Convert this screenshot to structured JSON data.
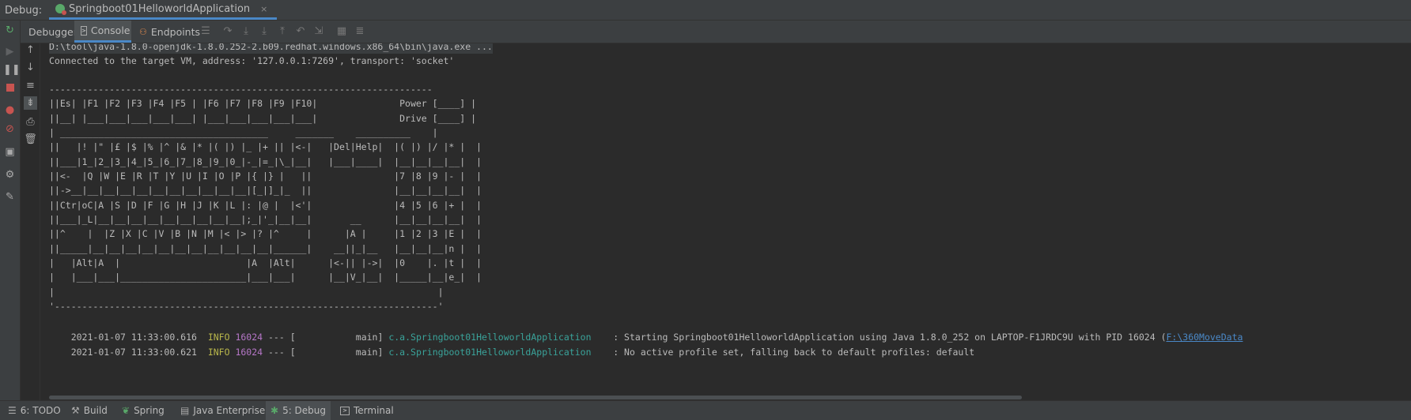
{
  "titlebar": {
    "label": "Debug:",
    "tab": "Springboot01HelloworldApplication",
    "close": "×"
  },
  "tabs": [
    {
      "label": "Debugger"
    },
    {
      "label": "Console"
    },
    {
      "label": "Endpoints"
    }
  ],
  "console": {
    "cmd": "D:\\tool\\java-1.8.0-openjdk-1.8.0.252-2.b09.redhat.windows.x86_64\\bin\\java.exe ...",
    "connected": "Connected to the target VM, address: '127.0.0.1:7269', transport: 'socket'",
    "ascii": [
      "",
      "----------------------------------------------------------------------",
      "||Es| |F1 |F2 |F3 |F4 |F5 | |F6 |F7 |F8 |F9 |F10|               Power [____] |",
      "||__| |___|___|___|___|___| |___|___|___|___|___|               Drive [____] |",
      "| ______________________________________     _______    __________    |",
      "||   |! |\" |£ |$ |% |^ |& |* |( |) |_ |+ || |<-|   |Del|Help|  |( |) |/ |* |  |",
      "||___|1_|2_|3_|4_|5_|6_|7_|8_|9_|0_|-_|=_|\\_|__|   |___|____|  |__|__|__|__|  |",
      "||<-  |Q |W |E |R |T |Y |U |I |O |P |{ |} |   ||               |7 |8 |9 |- |  |",
      "||->__|__|__|__|__|__|__|__|__|__|__|[_|]_|_  ||               |__|__|__|__|  |",
      "||Ctr|oC|A |S |D |F |G |H |J |K |L |: |@ |  |<'|               |4 |5 |6 |+ |  |",
      "||___|_L|__|__|__|__|__|__|__|__|__|;_|'_|__|__|       __      |__|__|__|__|  |",
      "||^    |  |Z |X |C |V |B |N |M |< |> |? |^     |      |A |     |1 |2 |3 |E |  |",
      "||_____|__|__|__|__|__|__|__|__|__|__|__|______|    __||_|__   |__|__|__|n |  |",
      "|   |Alt|A  |                       |A  |Alt|      |<-|| |->|  |0    |. |t |  |",
      "|   |___|___|_______________________|___|___|      |__|V_|__|  |_____|__|e_|  |",
      "|                                                                      |",
      "'----------------------------------------------------------------------'"
    ],
    "logs": [
      {
        "ts": "2021-01-07 11:33:00.616",
        "level": "INFO",
        "pid": "16024",
        "sep": " --- [",
        "thread": "           main] ",
        "logger": "c.a.Springboot01HelloworldApplication",
        "msg": "    : Starting Springboot01HelloworldApplication using Java 1.8.0_252 on LAPTOP-F1JRDC9U with PID 16024 (",
        "link": "F:\\360MoveData"
      },
      {
        "ts": "2021-01-07 11:33:00.621",
        "level": "INFO",
        "pid": "16024",
        "sep": " --- [",
        "thread": "           main] ",
        "logger": "c.a.Springboot01HelloworldApplication",
        "msg": "    : No active profile set, falling back to default profiles: default",
        "link": ""
      }
    ]
  },
  "bottom_tabs": [
    {
      "label": "6: TODO"
    },
    {
      "label": "Build"
    },
    {
      "label": "Spring"
    },
    {
      "label": "Java Enterprise"
    },
    {
      "label": "5: Debug"
    },
    {
      "label": "Terminal"
    }
  ],
  "colors": {
    "accent": "#4a88c7",
    "background": "#2b2b2b",
    "info": "#b9b74b",
    "pid": "#b677c8",
    "logger": "#3aa39a",
    "stop": "#c75450",
    "resume": "#59a869"
  }
}
